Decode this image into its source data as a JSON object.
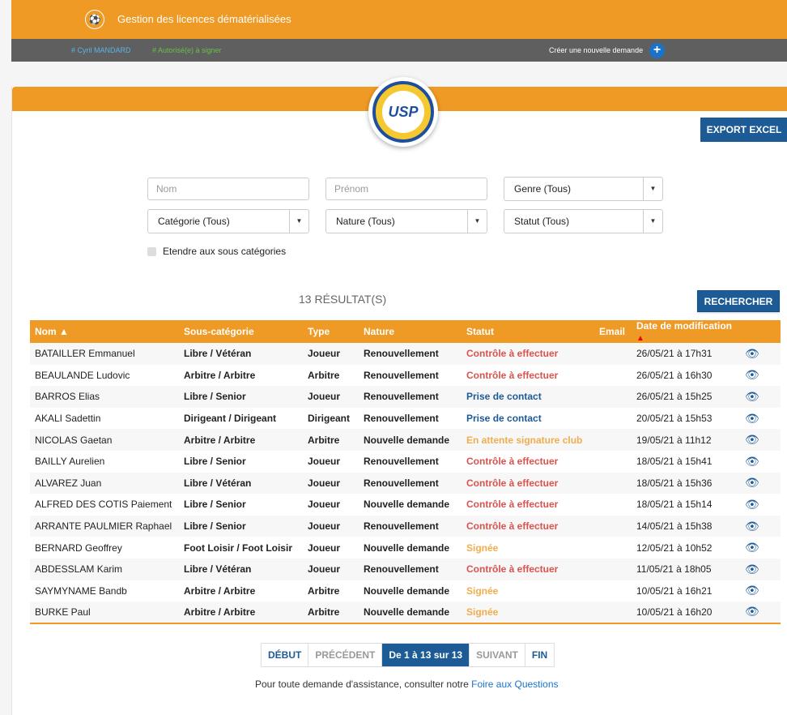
{
  "header": {
    "logo_icon": "fff-logo-icon",
    "title": "Gestion des licences dématérialisées"
  },
  "userbar": {
    "user": "# Cyril MANDARD",
    "authorization": "# Autorisé(e) à signer",
    "create_label": "Créer une nouvelle demande",
    "create_icon": "+"
  },
  "club": {
    "logo_text": "USP"
  },
  "buttons": {
    "export": "EXPORT EXCEL",
    "search": "RECHERCHER"
  },
  "filters": {
    "nom_placeholder": "Nom",
    "prenom_placeholder": "Prénom",
    "genre": "Genre (Tous)",
    "categorie": "Catégorie (Tous)",
    "nature": "Nature (Tous)",
    "statut": "Statut (Tous)",
    "extend_label": "Etendre aux sous catégories"
  },
  "results_label": "13 RÉSULTAT(S)",
  "table": {
    "headers": {
      "nom": "Nom ▲",
      "souscat": "Sous-catégorie",
      "type": "Type",
      "nature": "Nature",
      "statut": "Statut",
      "email": "Email",
      "date": "Date de modification"
    },
    "rows": [
      {
        "nom": "BATAILLER Emmanuel",
        "souscat": "Libre / Vétéran",
        "type": "Joueur",
        "nature": "Renouvellement",
        "statut": "Contrôle à effectuer",
        "status_color": "red",
        "date": "26/05/21 à 17h31"
      },
      {
        "nom": "BEAULANDE Ludovic",
        "souscat": "Arbitre / Arbitre",
        "type": "Arbitre",
        "nature": "Renouvellement",
        "statut": "Contrôle à effectuer",
        "status_color": "red",
        "date": "26/05/21 à 16h30"
      },
      {
        "nom": "BARROS Elias",
        "souscat": "Libre / Senior",
        "type": "Joueur",
        "nature": "Renouvellement",
        "statut": "Prise de contact",
        "status_color": "blue",
        "date": "26/05/21 à 15h25"
      },
      {
        "nom": "AKALI Sadettin",
        "souscat": "Dirigeant / Dirigeant",
        "type": "Dirigeant",
        "nature": "Renouvellement",
        "statut": "Prise de contact",
        "status_color": "blue",
        "date": "20/05/21 à 15h53"
      },
      {
        "nom": "NICOLAS Gaetan",
        "souscat": "Arbitre / Arbitre",
        "type": "Arbitre",
        "nature": "Nouvelle demande",
        "statut": "En attente signature club",
        "status_color": "orange",
        "date": "19/05/21 à 11h12"
      },
      {
        "nom": "BAILLY Aurelien",
        "souscat": "Libre / Senior",
        "type": "Joueur",
        "nature": "Renouvellement",
        "statut": "Contrôle à effectuer",
        "status_color": "red",
        "date": "18/05/21 à 15h41"
      },
      {
        "nom": "ALVAREZ Juan",
        "souscat": "Libre / Vétéran",
        "type": "Joueur",
        "nature": "Renouvellement",
        "statut": "Contrôle à effectuer",
        "status_color": "red",
        "date": "18/05/21 à 15h36"
      },
      {
        "nom": "ALFRED DES COTIS Paiement",
        "souscat": "Libre / Senior",
        "type": "Joueur",
        "nature": "Nouvelle demande",
        "statut": "Contrôle à effectuer",
        "status_color": "red",
        "date": "18/05/21 à 15h14"
      },
      {
        "nom": "ARRANTE PAULMIER Raphael",
        "souscat": "Libre / Senior",
        "type": "Joueur",
        "nature": "Renouvellement",
        "statut": "Contrôle à effectuer",
        "status_color": "red",
        "date": "14/05/21 à 15h38"
      },
      {
        "nom": "BERNARD Geoffrey",
        "souscat": "Foot Loisir / Foot Loisir",
        "type": "Joueur",
        "nature": "Nouvelle demande",
        "statut": "Signée",
        "status_color": "orange",
        "date": "12/05/21 à 10h52"
      },
      {
        "nom": "ABDESSLAM Karim",
        "souscat": "Libre / Vétéran",
        "type": "Joueur",
        "nature": "Renouvellement",
        "statut": "Contrôle à effectuer",
        "status_color": "red",
        "date": "11/05/21 à 18h05"
      },
      {
        "nom": "SAYMYNAME Bandb",
        "souscat": "Arbitre / Arbitre",
        "type": "Arbitre",
        "nature": "Nouvelle demande",
        "statut": "Signée",
        "status_color": "orange",
        "date": "10/05/21 à 16h21"
      },
      {
        "nom": "BURKE Paul",
        "souscat": "Arbitre / Arbitre",
        "type": "Arbitre",
        "nature": "Nouvelle demande",
        "statut": "Signée",
        "status_color": "orange",
        "date": "10/05/21 à 16h20"
      }
    ]
  },
  "pager": {
    "first": "DÉBUT",
    "prev": "PRÉCÉDENT",
    "current": "De 1 à 13 sur 13",
    "next": "SUIVANT",
    "last": "FIN"
  },
  "help": {
    "text": "Pour toute demande d'assistance, consulter notre ",
    "link": "Foire aux Questions"
  },
  "colors": {
    "orange": "#ef9a25",
    "dark_grey": "#5f5f5f",
    "blue": "#1c5b95",
    "red": "#d9534f"
  }
}
